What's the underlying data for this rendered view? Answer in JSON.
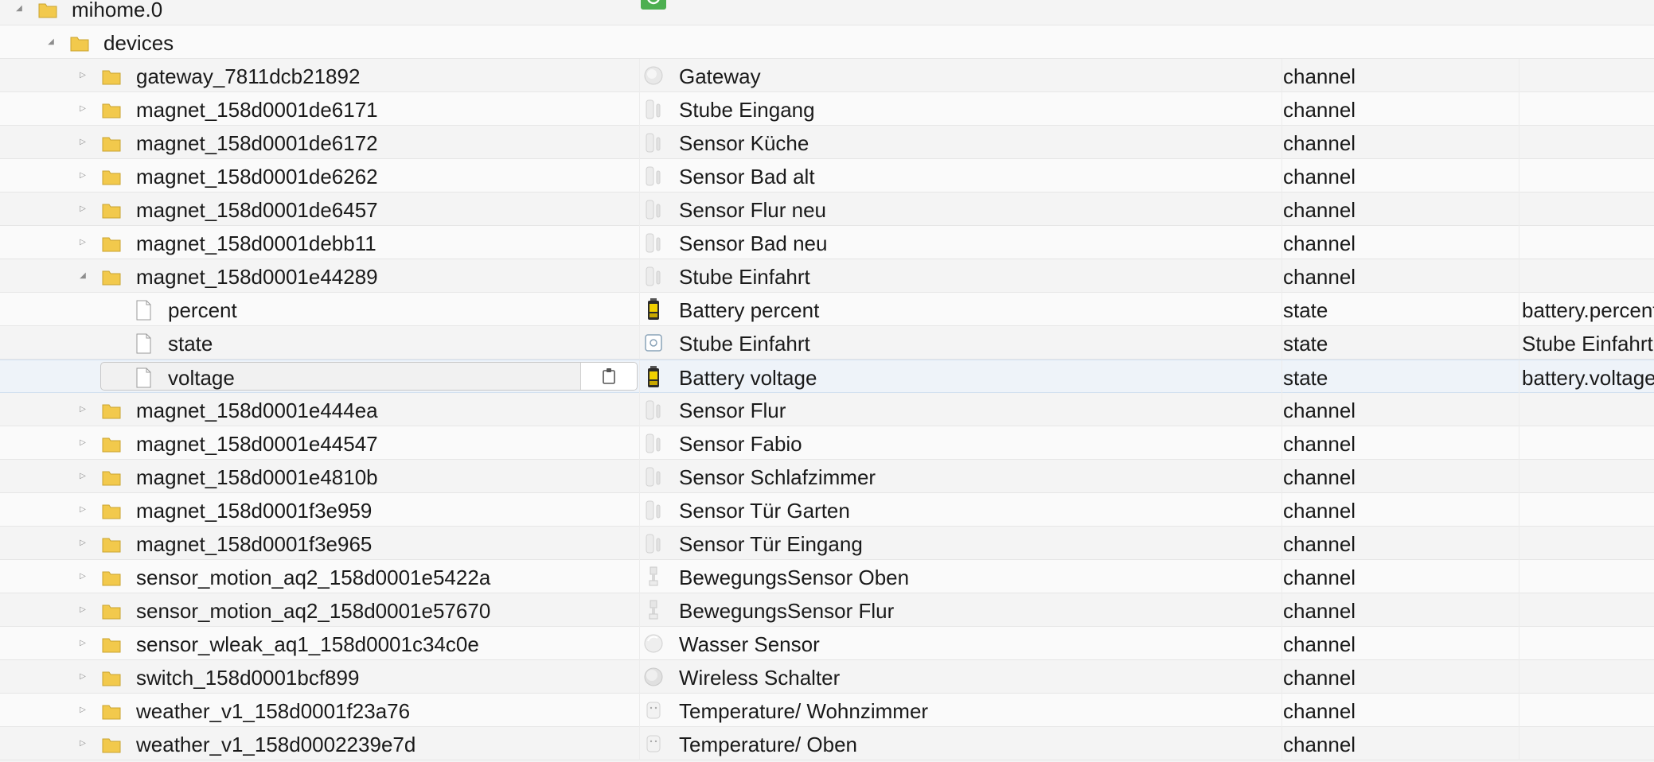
{
  "tree": {
    "root": {
      "name": "mihome.0",
      "expanded": true
    },
    "devices": {
      "name": "devices",
      "expanded": true
    },
    "rows": [
      {
        "name": "gateway_7811dcb21892",
        "kind": "folder",
        "expanded": false,
        "desc_icon": "gateway-icon",
        "desc": "Gateway",
        "type": "channel",
        "role": ""
      },
      {
        "name": "magnet_158d0001de6171",
        "kind": "folder",
        "expanded": false,
        "desc_icon": "door-sensor-icon",
        "desc": "Stube Eingang",
        "type": "channel",
        "role": ""
      },
      {
        "name": "magnet_158d0001de6172",
        "kind": "folder",
        "expanded": false,
        "desc_icon": "door-sensor-icon",
        "desc": "Sensor Küche",
        "type": "channel",
        "role": ""
      },
      {
        "name": "magnet_158d0001de6262",
        "kind": "folder",
        "expanded": false,
        "desc_icon": "door-sensor-icon",
        "desc": "Sensor Bad alt",
        "type": "channel",
        "role": ""
      },
      {
        "name": "magnet_158d0001de6457",
        "kind": "folder",
        "expanded": false,
        "desc_icon": "door-sensor-icon",
        "desc": "Sensor Flur neu",
        "type": "channel",
        "role": ""
      },
      {
        "name": "magnet_158d0001debb11",
        "kind": "folder",
        "expanded": false,
        "desc_icon": "door-sensor-icon",
        "desc": "Sensor Bad neu",
        "type": "channel",
        "role": ""
      },
      {
        "name": "magnet_158d0001e44289",
        "kind": "folder",
        "expanded": true,
        "desc_icon": "door-sensor-icon",
        "desc": "Stube Einfahrt",
        "type": "channel",
        "role": ""
      },
      {
        "name": "percent",
        "kind": "file",
        "desc_icon": "battery-icon",
        "desc": "Battery percent",
        "type": "state",
        "role": "battery.percent"
      },
      {
        "name": "state",
        "kind": "file",
        "desc_icon": "window-state-icon",
        "desc": "Stube Einfahrt",
        "type": "state",
        "role": "Stube Einfahrt"
      },
      {
        "name": "voltage",
        "kind": "file",
        "selected": true,
        "desc_icon": "battery-icon",
        "desc": "Battery voltage",
        "type": "state",
        "role": "battery.voltage"
      },
      {
        "name": "magnet_158d0001e444ea",
        "kind": "folder",
        "expanded": false,
        "desc_icon": "door-sensor-icon",
        "desc": "Sensor Flur",
        "type": "channel",
        "role": ""
      },
      {
        "name": "magnet_158d0001e44547",
        "kind": "folder",
        "expanded": false,
        "desc_icon": "door-sensor-icon",
        "desc": "Sensor Fabio",
        "type": "channel",
        "role": ""
      },
      {
        "name": "magnet_158d0001e4810b",
        "kind": "folder",
        "expanded": false,
        "desc_icon": "door-sensor-icon",
        "desc": "Sensor Schlafzimmer",
        "type": "channel",
        "role": ""
      },
      {
        "name": "magnet_158d0001f3e959",
        "kind": "folder",
        "expanded": false,
        "desc_icon": "door-sensor-icon",
        "desc": "Sensor Tür Garten",
        "type": "channel",
        "role": ""
      },
      {
        "name": "magnet_158d0001f3e965",
        "kind": "folder",
        "expanded": false,
        "desc_icon": "door-sensor-icon",
        "desc": "Sensor Tür Eingang",
        "type": "channel",
        "role": ""
      },
      {
        "name": "sensor_motion_aq2_158d0001e5422a",
        "kind": "folder",
        "expanded": false,
        "desc_icon": "motion-sensor-icon",
        "desc": "BewegungsSensor Oben",
        "type": "channel",
        "role": ""
      },
      {
        "name": "sensor_motion_aq2_158d0001e57670",
        "kind": "folder",
        "expanded": false,
        "desc_icon": "motion-sensor-icon",
        "desc": "BewegungsSensor Flur",
        "type": "channel",
        "role": ""
      },
      {
        "name": "sensor_wleak_aq1_158d0001c34c0e",
        "kind": "folder",
        "expanded": false,
        "desc_icon": "water-sensor-icon",
        "desc": "Wasser Sensor",
        "type": "channel",
        "role": ""
      },
      {
        "name": "switch_158d0001bcf899",
        "kind": "folder",
        "expanded": false,
        "desc_icon": "wireless-switch-icon",
        "desc": "Wireless Schalter",
        "type": "channel",
        "role": ""
      },
      {
        "name": "weather_v1_158d0001f23a76",
        "kind": "folder",
        "expanded": false,
        "desc_icon": "weather-sensor-icon",
        "desc": "Temperature/ Wohnzimmer",
        "type": "channel",
        "role": ""
      },
      {
        "name": "weather_v1_158d0002239e7d",
        "kind": "folder",
        "expanded": false,
        "desc_icon": "weather-sensor-icon",
        "desc": "Temperature/ Oben",
        "type": "channel",
        "role": ""
      }
    ]
  },
  "buttons": {
    "refresh_icon": "refresh-icon",
    "clipboard_icon": "clipboard-icon"
  },
  "colors": {
    "folder": "#f2c94c",
    "refresh_bg": "#4caf50",
    "selected_row": "#eef3f9"
  }
}
